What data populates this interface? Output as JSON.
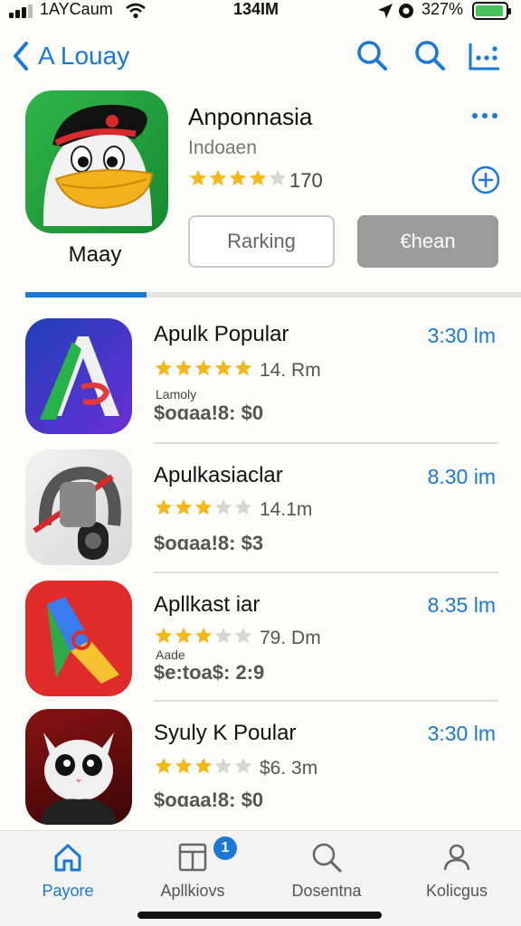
{
  "status_bar": {
    "carrier": "1AYCaum",
    "time": "134IM",
    "battery_pct": "327%"
  },
  "nav": {
    "back_label": "A Louay"
  },
  "featured": {
    "title": "Anponnasia",
    "subtitle": "Indoaen",
    "rating_count": "170",
    "stars": 4,
    "caption": "Maay",
    "btn_ranking": "Rarking",
    "btn_get": "€hean"
  },
  "list": [
    {
      "title": "Apulk Popular",
      "time": "3:30 lm",
      "rating_text": "14. Rm",
      "stars": 5,
      "tag": "Lamoly",
      "price": "$oɑaa!8:  $0"
    },
    {
      "title": "Apulkasiaclar",
      "time": "8.30 im",
      "rating_text": "14.1m",
      "stars": 3,
      "tag": "",
      "price": "$oɑaa!8:  $3"
    },
    {
      "title": "Apllkast iar",
      "time": "8.35 lm",
      "rating_text": "79. Dm",
      "stars": 3,
      "tag": "Aade",
      "price": "$e:toa$: 2:9"
    },
    {
      "title": "Syuly K Poular",
      "time": "3:30 lm",
      "rating_text": "$6. 3m",
      "stars": 3,
      "tag": "",
      "price": "$oɑaa!8:  $0"
    }
  ],
  "tabbar": {
    "items": [
      "Payore",
      "Apllkiovs",
      "Dosentna",
      "Kolicgus"
    ],
    "badge": "1"
  },
  "colors": {
    "accent": "#1a78d6",
    "star": "#f5b819",
    "star_empty": "#d6d6d6"
  }
}
